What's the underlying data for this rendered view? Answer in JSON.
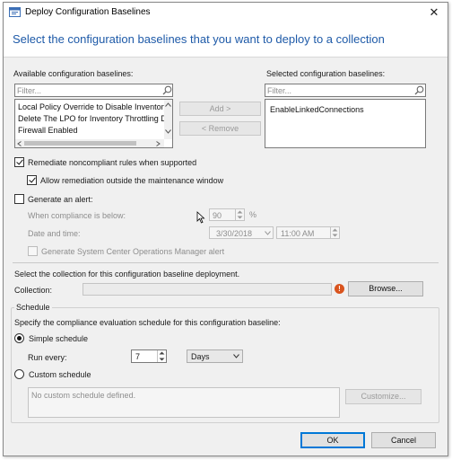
{
  "window": {
    "title": "Deploy Configuration Baselines",
    "close_glyph": "✕"
  },
  "header": {
    "text": "Select the configuration baselines that you want to deploy to a collection"
  },
  "available": {
    "label": "Available configuration baselines:",
    "filter_placeholder": "Filter...",
    "items": [
      "Local Policy Override to Disable Inventory ...",
      "Delete The LPO for Inventory Throttling Di...",
      "Firewall Enabled"
    ]
  },
  "selected": {
    "label": "Selected configuration baselines:",
    "filter_placeholder": "Filter...",
    "items": [
      "EnableLinkedConnections"
    ]
  },
  "buttons": {
    "add": "Add >",
    "remove": "< Remove",
    "browse": "Browse...",
    "customize": "Customize...",
    "ok": "OK",
    "cancel": "Cancel"
  },
  "remediation": {
    "remediate_label": "Remediate noncompliant rules when supported",
    "remediate_checked": true,
    "outside_window_label": "Allow remediation outside the maintenance window",
    "outside_window_checked": true
  },
  "alert": {
    "generate_label": "Generate an alert:",
    "generate_checked": false,
    "compliance_label": "When compliance is below:",
    "compliance_value": "90",
    "percent_sign": "%",
    "date_label": "Date and time:",
    "date_value": "3/30/2018",
    "time_value": "11:00 AM",
    "scom_label": "Generate System Center Operations Manager alert",
    "scom_checked": false
  },
  "collection": {
    "intro": "Select the collection for this configuration baseline deployment.",
    "label": "Collection:",
    "value": ""
  },
  "schedule": {
    "legend": "Schedule",
    "intro": "Specify the compliance evaluation schedule for this configuration baseline:",
    "simple_label": "Simple schedule",
    "simple_selected": true,
    "run_every_label": "Run every:",
    "run_every_value": "7",
    "unit_value": "Days",
    "custom_label": "Custom schedule",
    "custom_selected": false,
    "custom_placeholder": "No custom schedule defined."
  },
  "icons": {
    "search": "search-icon",
    "chevron_up": "chevron-up-icon",
    "chevron_down": "chevron-down-icon",
    "chevron_left": "chevron-left-icon",
    "chevron_right": "chevron-right-icon",
    "calendar_dropdown": "chevron-down-icon",
    "warning": "warning-icon"
  },
  "colors": {
    "header_text": "#1e5aa8",
    "primary_button_border": "#0078d7",
    "warning": "#d9541e"
  }
}
